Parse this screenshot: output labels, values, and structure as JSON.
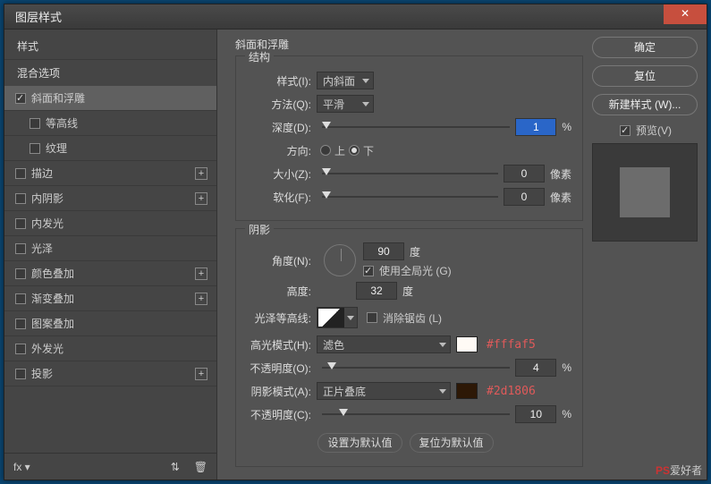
{
  "window": {
    "title": "图层样式",
    "close": "✕"
  },
  "sidebar": {
    "styles": "样式",
    "blend": "混合选项",
    "items": [
      {
        "label": "斜面和浮雕",
        "checked": true,
        "selected": true
      },
      {
        "label": "等高线",
        "checked": false,
        "sub": true
      },
      {
        "label": "纹理",
        "checked": false,
        "sub": true
      },
      {
        "label": "描边",
        "checked": false,
        "plus": true
      },
      {
        "label": "内阴影",
        "checked": false,
        "plus": true
      },
      {
        "label": "内发光",
        "checked": false
      },
      {
        "label": "光泽",
        "checked": false
      },
      {
        "label": "颜色叠加",
        "checked": false,
        "plus": true
      },
      {
        "label": "渐变叠加",
        "checked": false,
        "plus": true
      },
      {
        "label": "图案叠加",
        "checked": false
      },
      {
        "label": "外发光",
        "checked": false
      },
      {
        "label": "投影",
        "checked": false,
        "plus": true
      }
    ],
    "footer": {
      "fx": "fx",
      "trash": "🗑"
    }
  },
  "panel": {
    "title": "斜面和浮雕",
    "struct": {
      "legend": "结构",
      "style_lbl": "样式(I):",
      "style_val": "内斜面",
      "method_lbl": "方法(Q):",
      "method_val": "平滑",
      "depth_lbl": "深度(D):",
      "depth_val": "1",
      "depth_unit": "%",
      "dir_lbl": "方向:",
      "up": "上",
      "down": "下",
      "size_lbl": "大小(Z):",
      "size_val": "0",
      "size_unit": "像素",
      "soft_lbl": "软化(F):",
      "soft_val": "0",
      "soft_unit": "像素"
    },
    "shade": {
      "legend": "阴影",
      "angle_lbl": "角度(N):",
      "angle_val": "90",
      "angle_unit": "度",
      "global_lbl": "使用全局光 (G)",
      "alt_lbl": "高度:",
      "alt_val": "32",
      "alt_unit": "度",
      "gloss_lbl": "光泽等高线:",
      "aa_lbl": "消除锯齿 (L)",
      "hi_mode_lbl": "高光模式(H):",
      "hi_mode_val": "滤色",
      "hi_color": "#fffaf5",
      "hi_note": "#fffaf5",
      "hi_op_lbl": "不透明度(O):",
      "hi_op_val": "4",
      "hi_op_unit": "%",
      "sh_mode_lbl": "阴影模式(A):",
      "sh_mode_val": "正片叠底",
      "sh_color": "#2d1806",
      "sh_note": "#2d1806",
      "sh_op_lbl": "不透明度(C):",
      "sh_op_val": "10",
      "sh_op_unit": "%"
    },
    "defaults": {
      "set": "设置为默认值",
      "reset": "复位为默认值"
    }
  },
  "buttons": {
    "ok": "确定",
    "cancel": "复位",
    "newstyle": "新建样式 (W)...",
    "preview": "预览(V)"
  },
  "watermark": {
    "left": "",
    "right_a": "PS",
    "right_b": "爱好者"
  }
}
